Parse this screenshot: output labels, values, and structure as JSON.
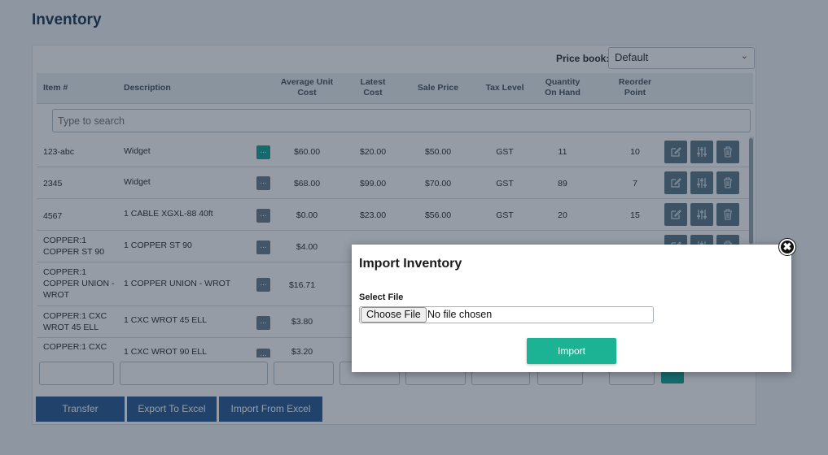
{
  "page": {
    "title": "Inventory"
  },
  "price_book": {
    "label": "Price book:",
    "selected": "Default"
  },
  "table": {
    "headers": {
      "item": "Item #",
      "description": "Description",
      "avg_cost_1": "Average Unit",
      "avg_cost_2": "Cost",
      "latest_cost_1": "Latest",
      "latest_cost_2": "Cost",
      "sale_price": "Sale Price",
      "tax_level": "Tax Level",
      "qty_1": "Quantity",
      "qty_2": "On Hand",
      "reorder_1": "Reorder",
      "reorder_2": "Point"
    },
    "search_placeholder": "Type to search",
    "rows": [
      {
        "item": "123-abc",
        "description": "Widget",
        "avg_cost": "$60.00",
        "latest_cost": "$20.00",
        "sale_price": "$50.00",
        "tax": "GST",
        "qty": "11",
        "reorder": "10"
      },
      {
        "item": "2345",
        "description": "Widget",
        "avg_cost": "$68.00",
        "latest_cost": "$99.00",
        "sale_price": "$70.00",
        "tax": "GST",
        "qty": "89",
        "reorder": "7"
      },
      {
        "item": "4567",
        "description": "1 CABLE XGXL-88 40ft",
        "avg_cost": "$0.00",
        "latest_cost": "$23.00",
        "sale_price": "$56.00",
        "tax": "GST",
        "qty": "20",
        "reorder": "15"
      },
      {
        "item_l1": "COPPER:1",
        "item_l2": "COPPER ST 90",
        "description": "1 COPPER ST 90",
        "avg_cost": "$4.00"
      },
      {
        "item_l1": "COPPER:1",
        "item_l2": "COPPER UNION -",
        "item_l3": "WROT",
        "description": "1 COPPER UNION - WROT",
        "avg_cost": "$16.71"
      },
      {
        "item_l1": "COPPER:1 CXC",
        "item_l2": "WROT 45 ELL",
        "description": "1 CXC WROT 45 ELL",
        "avg_cost": "$3.80"
      },
      {
        "item_l1": "COPPER:1 CXC",
        "description": "1 CXC WROT 90 ELL",
        "avg_cost": "$3.20"
      }
    ],
    "dots_label": "..."
  },
  "buttons": {
    "transfer": "Transfer",
    "export": "Export To Excel",
    "import": "Import From Excel"
  },
  "modal": {
    "title": "Import Inventory",
    "file_label": "Select File",
    "choose_button": "Choose File",
    "no_file": "No file chosen",
    "import_button": "Import",
    "close_glyph": "✖"
  },
  "colors": {
    "teal": "#1aa597",
    "primary_blue": "#2c5c95",
    "overlay": "rgba(20,35,55,0.45)"
  },
  "icons": [
    "edit-icon",
    "sliders-icon",
    "trash-icon",
    "chevron-down-icon",
    "close-icon"
  ]
}
